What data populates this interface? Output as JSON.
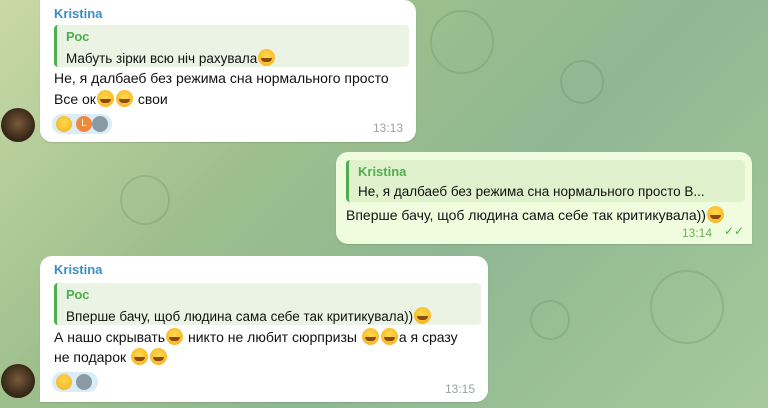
{
  "messages": [
    {
      "sender": "Kristina",
      "reply": {
        "name": "Рос",
        "text": "Мабуть зірки всю ніч рахувала"
      },
      "lines": [
        "Не, я далбаеб без режима сна нормального просто",
        "Все ок",
        "свои"
      ],
      "time": "13:13",
      "reaction_initial": "L"
    },
    {
      "sender": "Kristina",
      "reply": {
        "name": "Kristina",
        "text": "Не, я далбаеб без режима сна нормального просто В..."
      },
      "lines": [
        "Вперше бачу, щоб людина сама себе так критикувала))"
      ],
      "time": "13:14",
      "status": "read"
    },
    {
      "sender": "Kristina",
      "reply": {
        "name": "Рос",
        "text": "Вперше бачу, щоб людина сама себе так критикувала))"
      },
      "lines": [
        "А нашо скрывать",
        "никто не любит сюрпризы",
        "а я сразу",
        "не подарок"
      ],
      "time": "13:15"
    }
  ],
  "colors": {
    "accent": "#3a8fc9",
    "reply_bar": "#4fae4e",
    "outgoing_bg": "#effdde",
    "reaction_bg": "#d9ecf9"
  },
  "icons": {
    "emoji": "grinning-squinting-face",
    "read_status": "double-check-icon"
  }
}
